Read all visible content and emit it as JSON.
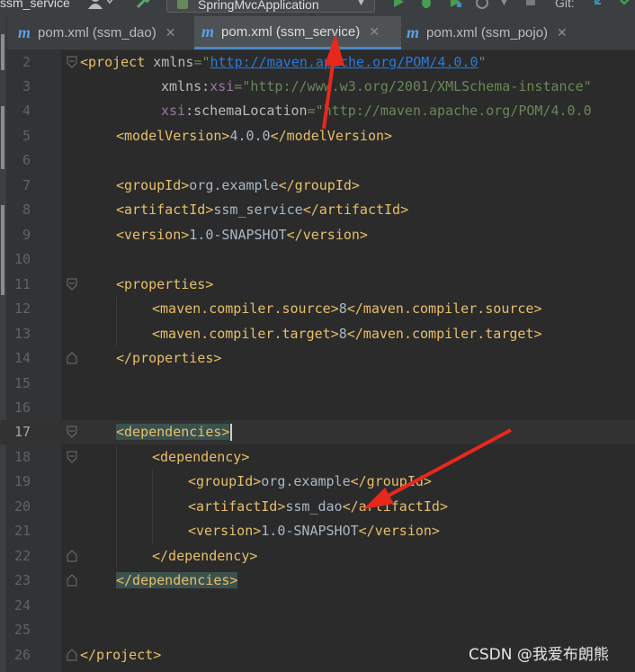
{
  "toolbar": {
    "project_label": "ssm_service",
    "run_config": "SpringMvcApplication",
    "git_label": "Git:"
  },
  "tabs": [
    {
      "label": "pom.xml (ssm_dao)",
      "active": false
    },
    {
      "label": "pom.xml (ssm_service)",
      "active": true
    },
    {
      "label": "pom.xml (ssm_pojo)",
      "active": false
    }
  ],
  "editor": {
    "current_line": "17",
    "lines": [
      {
        "num": "2"
      },
      {
        "num": "3"
      },
      {
        "num": "4"
      },
      {
        "num": "5"
      },
      {
        "num": "6"
      },
      {
        "num": "7"
      },
      {
        "num": "8"
      },
      {
        "num": "9"
      },
      {
        "num": "10"
      },
      {
        "num": "11"
      },
      {
        "num": "12"
      },
      {
        "num": "13"
      },
      {
        "num": "14"
      },
      {
        "num": "15"
      },
      {
        "num": "16"
      },
      {
        "num": "17"
      },
      {
        "num": "18"
      },
      {
        "num": "19"
      },
      {
        "num": "20"
      },
      {
        "num": "21"
      },
      {
        "num": "22"
      },
      {
        "num": "23"
      },
      {
        "num": "24"
      },
      {
        "num": "25"
      },
      {
        "num": "26"
      }
    ],
    "code": {
      "project_open": "project",
      "xmlns_attr": "xmlns",
      "xmlns_val": "http://maven.apache.org/POM/4.0.0",
      "xsi_prefix": "xmlns",
      "xsi_name": "xsi",
      "xsi_val": "\"http://www.w3.org/2001/XMLSchema-instance\"",
      "schema_prefix": "xsi",
      "schema_name": "schemaLocation",
      "schema_val": "\"http://maven.apache.org/POM/4.0.0",
      "model_version": "4.0.0",
      "group_id": "org.example",
      "artifact_id": "ssm_service",
      "version": "1.0-SNAPSHOT",
      "compiler_source": "8",
      "compiler_target": "8",
      "dep_group_id": "org.example",
      "dep_artifact_id": "ssm_dao",
      "dep_version": "1.0-SNAPSHOT"
    }
  },
  "watermark": "CSDN @我爱布朗熊"
}
